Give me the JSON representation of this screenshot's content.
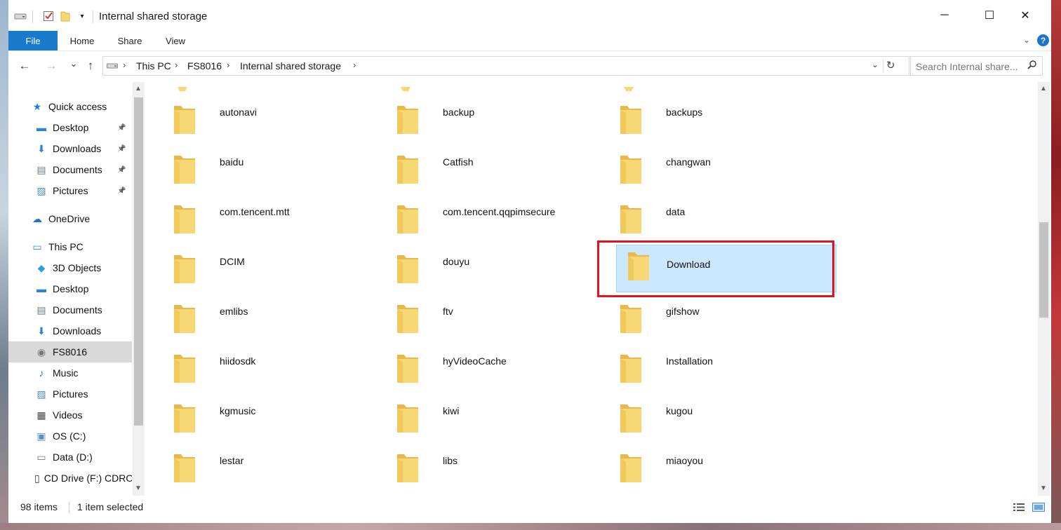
{
  "window": {
    "title": "Internal shared storage",
    "controls": {
      "minimize": "─",
      "maximize": "☐",
      "close": "✕"
    }
  },
  "ribbon": {
    "tabs": [
      "File",
      "Home",
      "Share",
      "View"
    ],
    "help": "?"
  },
  "nav": {
    "back": "←",
    "forward": "→",
    "recent": "⌄",
    "up": "↑",
    "breadcrumb": [
      "This PC",
      "FS8016",
      "Internal shared storage"
    ],
    "separator": "›",
    "search_placeholder": "Search Internal share..."
  },
  "sidebar": {
    "items": [
      {
        "label": "Quick access",
        "icon": "star-icon",
        "glyph": "★",
        "color": "#1e7fd8",
        "level": 0,
        "pinned": false,
        "selected": false
      },
      {
        "label": "Desktop",
        "icon": "desktop-folder-icon",
        "glyph": "▬",
        "color": "#2a82da",
        "level": 1,
        "pinned": true,
        "selected": false
      },
      {
        "label": "Downloads",
        "icon": "downloads-icon",
        "glyph": "⬇",
        "color": "#2a82da",
        "level": 1,
        "pinned": true,
        "selected": false
      },
      {
        "label": "Documents",
        "icon": "documents-icon",
        "glyph": "▤",
        "color": "#6d7d8c",
        "level": 1,
        "pinned": true,
        "selected": false
      },
      {
        "label": "Pictures",
        "icon": "pictures-icon",
        "glyph": "▨",
        "color": "#4a90c8",
        "level": 1,
        "pinned": true,
        "selected": false
      },
      {
        "label": "OneDrive",
        "icon": "cloud-icon",
        "glyph": "☁",
        "color": "#1f74d0",
        "level": 0,
        "pinned": false,
        "selected": false
      },
      {
        "label": "This PC",
        "icon": "computer-icon",
        "glyph": "▭",
        "color": "#3a88d0",
        "level": 0,
        "pinned": false,
        "selected": false
      },
      {
        "label": "3D Objects",
        "icon": "cube-icon",
        "glyph": "◆",
        "color": "#29a3d8",
        "level": 1,
        "pinned": false,
        "selected": false
      },
      {
        "label": "Desktop",
        "icon": "desktop-folder-icon",
        "glyph": "▬",
        "color": "#2a82da",
        "level": 1,
        "pinned": false,
        "selected": false
      },
      {
        "label": "Documents",
        "icon": "documents-icon",
        "glyph": "▤",
        "color": "#6d7d8c",
        "level": 1,
        "pinned": false,
        "selected": false
      },
      {
        "label": "Downloads",
        "icon": "downloads-icon",
        "glyph": "⬇",
        "color": "#2a82da",
        "level": 1,
        "pinned": false,
        "selected": false
      },
      {
        "label": "FS8016",
        "icon": "device-icon",
        "glyph": "◉",
        "color": "#777777",
        "level": 1,
        "pinned": false,
        "selected": true
      },
      {
        "label": "Music",
        "icon": "music-icon",
        "glyph": "♪",
        "color": "#2a82da",
        "level": 1,
        "pinned": false,
        "selected": false
      },
      {
        "label": "Pictures",
        "icon": "pictures-icon",
        "glyph": "▨",
        "color": "#4a90c8",
        "level": 1,
        "pinned": false,
        "selected": false
      },
      {
        "label": "Videos",
        "icon": "videos-icon",
        "glyph": "▦",
        "color": "#444444",
        "level": 1,
        "pinned": false,
        "selected": false
      },
      {
        "label": "OS (C:)",
        "icon": "windows-drive-icon",
        "glyph": "▣",
        "color": "#5a8fc4",
        "level": 1,
        "pinned": false,
        "selected": false
      },
      {
        "label": "Data (D:)",
        "icon": "drive-icon",
        "glyph": "▭",
        "color": "#777777",
        "level": 1,
        "pinned": false,
        "selected": false
      },
      {
        "label": "CD Drive (F:) CDROM",
        "icon": "cd-drive-icon",
        "glyph": "▯",
        "color": "#333333",
        "level": 1,
        "pinned": false,
        "selected": false
      }
    ]
  },
  "content": {
    "items": [
      {
        "name": "autonavi",
        "selected": false
      },
      {
        "name": "backup",
        "selected": false
      },
      {
        "name": "backups",
        "selected": false
      },
      {
        "name": "baidu",
        "selected": false
      },
      {
        "name": "Catfish",
        "selected": false
      },
      {
        "name": "changwan",
        "selected": false
      },
      {
        "name": "com.tencent.mtt",
        "selected": false
      },
      {
        "name": "com.tencent.qqpimsecure",
        "selected": false
      },
      {
        "name": "data",
        "selected": false
      },
      {
        "name": "DCIM",
        "selected": false
      },
      {
        "name": "douyu",
        "selected": false
      },
      {
        "name": "Download",
        "selected": true
      },
      {
        "name": "emlibs",
        "selected": false
      },
      {
        "name": "ftv",
        "selected": false
      },
      {
        "name": "gifshow",
        "selected": false
      },
      {
        "name": "hiidosdk",
        "selected": false
      },
      {
        "name": "hyVideoCache",
        "selected": false
      },
      {
        "name": "Installation",
        "selected": false
      },
      {
        "name": "kgmusic",
        "selected": false
      },
      {
        "name": "kiwi",
        "selected": false
      },
      {
        "name": "kugou",
        "selected": false
      },
      {
        "name": "lestar",
        "selected": false
      },
      {
        "name": "libs",
        "selected": false
      },
      {
        "name": "miaoyou",
        "selected": false
      }
    ]
  },
  "status": {
    "count": "98 items",
    "selection": "1 item selected"
  },
  "colors": {
    "accent": "#1979ca",
    "folder": "#f8d775",
    "selection": "#cce8ff",
    "highlight": "#e0141e"
  }
}
